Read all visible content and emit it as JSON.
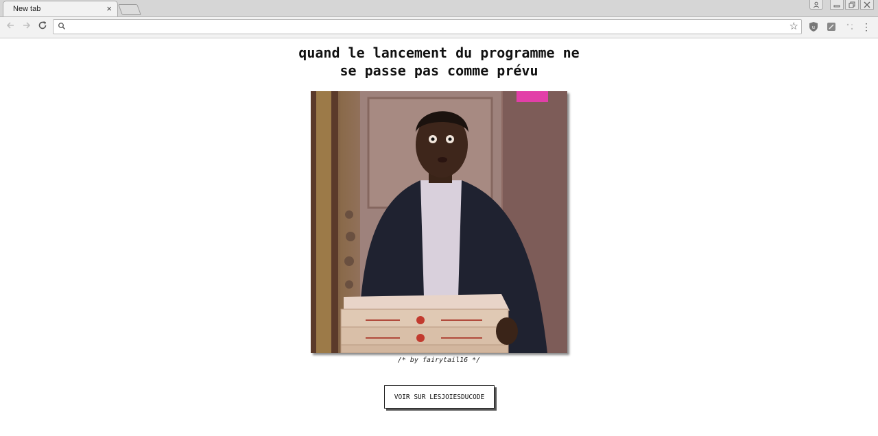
{
  "browser": {
    "tab_title": "New tab",
    "tab_close": "×",
    "omnibox_value": "",
    "omnibox_placeholder": ""
  },
  "page": {
    "headline_line1": "quand le lancement du programme ne",
    "headline_line2": "se passe pas comme prévu",
    "author": "/* by fairytail16 */",
    "cta_label": "VOIR SUR LESJOIESDUCODE"
  },
  "icons": {
    "back": "arrow-left-icon",
    "forward": "arrow-right-icon",
    "reload": "reload-icon",
    "search": "search-icon",
    "bookmark": "star-icon",
    "menu": "kebab-menu-icon"
  }
}
